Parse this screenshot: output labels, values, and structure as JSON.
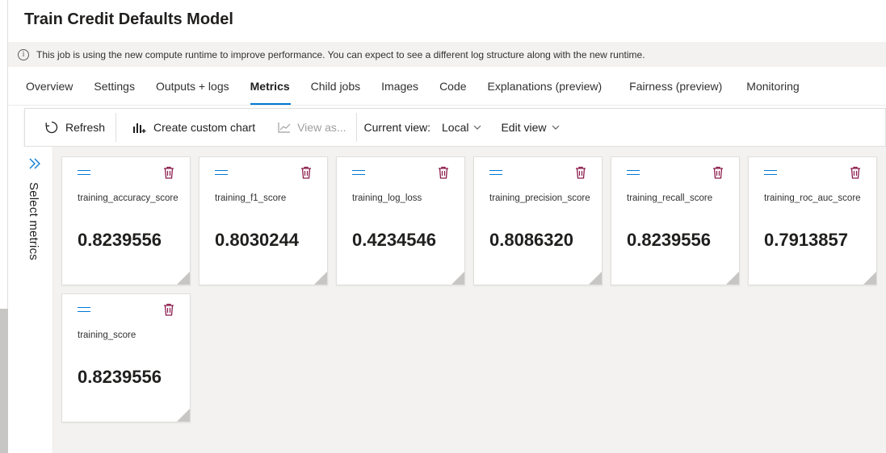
{
  "page": {
    "title": "Train Credit Defaults Model"
  },
  "info_bar": {
    "text": "This job is using the new compute runtime to improve performance. You can expect to see a different log structure along with the new runtime."
  },
  "tabs": [
    {
      "label": "Overview",
      "active": false
    },
    {
      "label": "Settings",
      "active": false
    },
    {
      "label": "Outputs + logs",
      "active": false
    },
    {
      "label": "Metrics",
      "active": true
    },
    {
      "label": "Child jobs",
      "active": false
    },
    {
      "label": "Images",
      "active": false
    },
    {
      "label": "Code",
      "active": false
    },
    {
      "label": "Explanations (preview)",
      "active": false
    },
    {
      "label": "Fairness (preview)",
      "active": false
    },
    {
      "label": "Monitoring",
      "active": false
    }
  ],
  "toolbar": {
    "refresh_label": "Refresh",
    "create_chart_label": "Create custom chart",
    "view_as_label": "View as...",
    "current_view_label": "Current view:",
    "current_view_value": "Local",
    "edit_view_label": "Edit view"
  },
  "side_panel": {
    "label": "Select metrics"
  },
  "metrics": [
    {
      "name": "training_accuracy_score",
      "value": "0.8239556"
    },
    {
      "name": "training_f1_score",
      "value": "0.8030244"
    },
    {
      "name": "training_log_loss",
      "value": "0.4234546"
    },
    {
      "name": "training_precision_score",
      "value": "0.8086320"
    },
    {
      "name": "training_recall_score",
      "value": "0.8239556"
    },
    {
      "name": "training_roc_auc_score",
      "value": "0.7913857"
    },
    {
      "name": "training_score",
      "value": "0.8239556"
    }
  ],
  "colors": {
    "accent": "#0078d4",
    "trash": "#8a1a4a",
    "content_bg": "#f3f2f1"
  }
}
